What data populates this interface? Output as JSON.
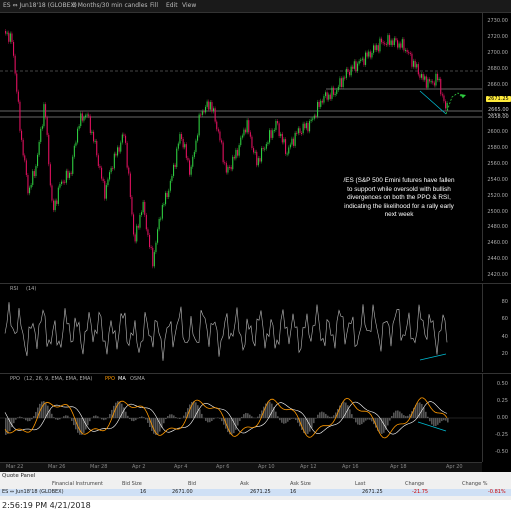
{
  "toolbar": {
    "symbol": "ES ⇔ Jun18'18 (GLOBEX)",
    "interval": "3 Months/30 min candles",
    "buttons": [
      "Fill",
      "Edit",
      "View"
    ]
  },
  "price_axis": {
    "ticks": [
      "2730.00",
      "2720.00",
      "2700.00",
      "2680.00",
      "2660.00",
      "2640.00",
      "2620.00",
      "2600.00",
      "2580.00",
      "2560.00",
      "2540.00",
      "2520.00",
      "2500.00",
      "2480.00",
      "2460.00",
      "2440.00",
      "2420.00"
    ],
    "last_price": "2671.25",
    "level_1": "2665.00",
    "level_2": "2658.00"
  },
  "annotation": "/ES (S&P 500 Emini futures have fallen to support while oversold with bullish divergences on both the PPO & RSI, indicating the likelihood for a rally early next week",
  "rsi": {
    "label": "RSI",
    "param": "(14)",
    "ticks": [
      "80",
      "60",
      "40",
      "20"
    ]
  },
  "ppo": {
    "label": "PPO",
    "params": "(12, 26, 9, EMA, EMA, EMA)",
    "legend": [
      "PPO",
      "MA",
      "OSMA"
    ],
    "ticks": [
      "0.50",
      "0.25",
      "0.00",
      "-0.25",
      "-0.50"
    ]
  },
  "date_axis": [
    "Mar 22",
    "Mar 26",
    "Mar 28",
    "Apr 2",
    "Apr 4",
    "Apr 6",
    "Apr 10",
    "Apr 12",
    "Apr 16",
    "Apr 18",
    "Apr 20"
  ],
  "quote_panel": {
    "title": "Quote Panel",
    "headers": [
      "Financial Instrument",
      "Bid Size",
      "Bid",
      "Ask",
      "Ask Size",
      "Last",
      "Change",
      "Change %"
    ],
    "row": {
      "instrument": "ES ⇔ Jun18'18 (GLOBEX)",
      "bid_size": "16",
      "bid": "2671.00",
      "ask": "2671.25",
      "ask_size": "16",
      "last": "2671.25",
      "change": "-21.75",
      "change_pct": "-0.81%"
    }
  },
  "status_bar": {
    "timestamp": "2:56:19 PM 4/21/2018"
  },
  "colors": {
    "up_candle": "#2ecc40",
    "down_candle": "#e0115f",
    "ppo_line": "#ff9900",
    "ma_line": "#ffffff",
    "divergence": "#00bcd4"
  }
}
